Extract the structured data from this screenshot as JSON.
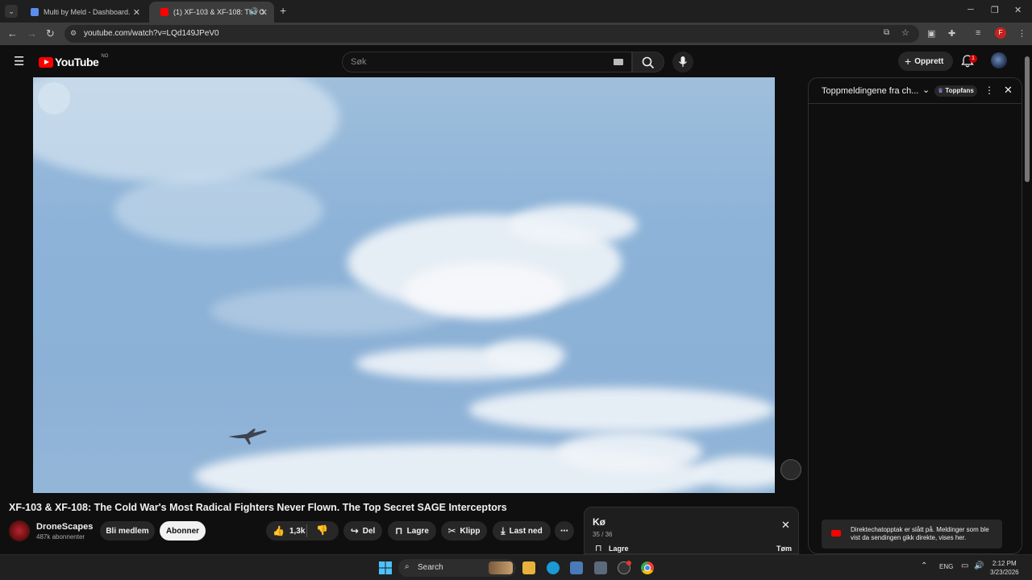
{
  "browser": {
    "tabs": [
      {
        "label": "Multi by Meld - Dashboard.",
        "active": false
      },
      {
        "label": "(1) XF-103 & XF-108: The C",
        "active": true
      }
    ],
    "new_tab": "+",
    "url": "youtube.com/watch?v=LQd149JPeV0",
    "profile_initial": "F"
  },
  "youtube": {
    "logo_text": "YouTube",
    "country_code": "NO",
    "search_placeholder": "Søk",
    "create_label": "Opprett",
    "notification_count": "1"
  },
  "video": {
    "title": "XF-103 & XF-108: The Cold War's Most Radical Fighters Never Flown. The Top Secret SAGE Interceptors",
    "sky_color": "#8db3d8"
  },
  "channel": {
    "name": "DroneScapes",
    "subscribers": "487k abonnenter",
    "join_label": "Bli medlem",
    "subscribe_label": "Abonner"
  },
  "actions": {
    "likes": "1,3k",
    "share": "Del",
    "save": "Lagre",
    "clip": "Klipp",
    "download": "Last ned",
    "more": "⋯"
  },
  "chat": {
    "title": "Toppmeldingene fra ch...",
    "badge": "Toppfans",
    "notice": "Direktechatopptak er slått på. Meldinger som ble vist da sendingen gikk direkte, vises her."
  },
  "queue": {
    "title": "Kø",
    "count": "35 / 36",
    "save": "Lagre",
    "clear": "Tøm"
  },
  "taskbar": {
    "search": "Search",
    "lang": "ENG",
    "time": "2:12 PM",
    "date": "3/23/2026"
  }
}
